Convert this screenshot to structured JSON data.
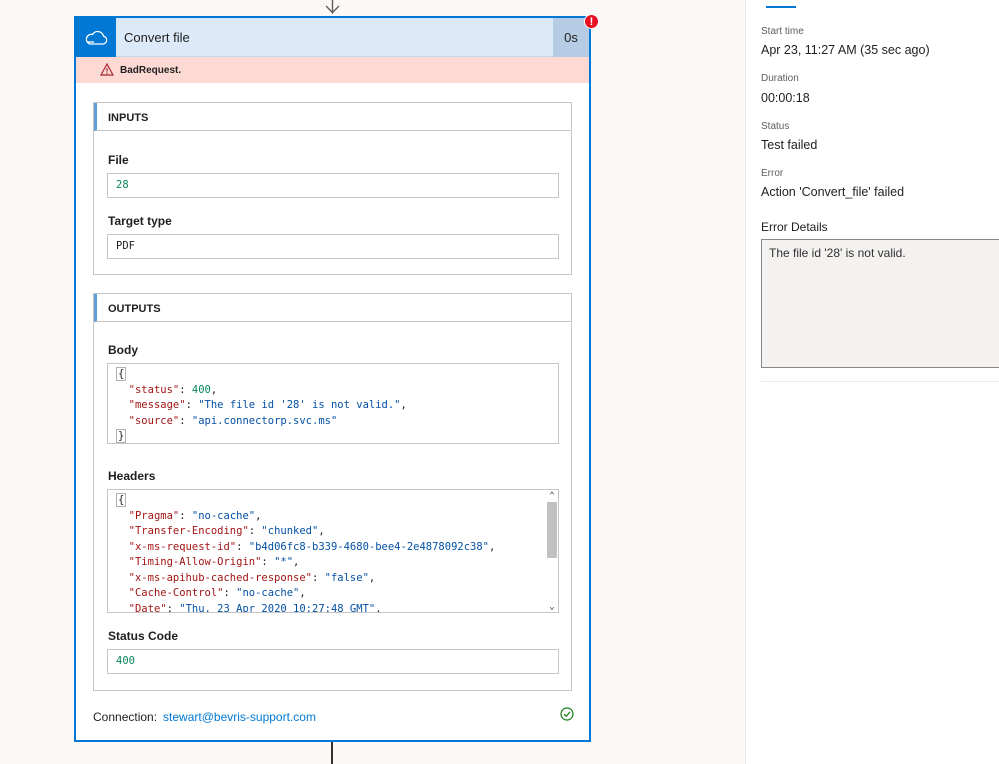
{
  "card": {
    "title": "Convert file",
    "duration": "0s",
    "error_badge": "!",
    "error_message": "BadRequest.",
    "connection_label": "Connection:",
    "connection_account": "stewart@bevris-support.com"
  },
  "inputs": {
    "heading": "INPUTS",
    "file_label": "File",
    "file_value": "28",
    "target_type_label": "Target type",
    "target_type_value": "PDF"
  },
  "outputs": {
    "heading": "OUTPUTS",
    "body_label": "Body",
    "body": {
      "status_key": "\"status\"",
      "status_value": "400",
      "message_key": "\"message\"",
      "message_value": "\"The file id '28' is not valid.\"",
      "source_key": "\"source\"",
      "source_value": "\"api.connectorp.svc.ms\""
    },
    "headers_label": "Headers",
    "headers": [
      {
        "key": "\"Pragma\"",
        "value": "\"no-cache\""
      },
      {
        "key": "\"Transfer-Encoding\"",
        "value": "\"chunked\""
      },
      {
        "key": "\"x-ms-request-id\"",
        "value": "\"b4d06fc8-b339-4680-bee4-2e4878092c38\""
      },
      {
        "key": "\"Timing-Allow-Origin\"",
        "value": "\"*\""
      },
      {
        "key": "\"x-ms-apihub-cached-response\"",
        "value": "\"false\""
      },
      {
        "key": "\"Cache-Control\"",
        "value": "\"no-cache\""
      },
      {
        "key": "\"Date\"",
        "value": "\"Thu, 23 Apr 2020 10:27:48 GMT\""
      }
    ],
    "status_code_label": "Status Code",
    "status_code_value": "400"
  },
  "panel": {
    "start_time_label": "Start time",
    "start_time_value": "Apr 23, 11:27 AM (35 sec ago)",
    "duration_label": "Duration",
    "duration_value": "00:00:18",
    "status_label": "Status",
    "status_value": "Test failed",
    "error_label": "Error",
    "error_value": "Action 'Convert_file' failed",
    "error_details_label": "Error Details",
    "error_details_value": "The file id '28' is not valid."
  },
  "colors": {
    "accent": "#0078d4",
    "error_bg": "#fdd9d4",
    "header_bg": "#dbe9f8",
    "success": "#107c10",
    "error": "#e81123"
  },
  "icons": {
    "card": "onedrive-cloud-icon",
    "error": "warning-triangle-icon",
    "connection_status": "check-circle-icon"
  }
}
